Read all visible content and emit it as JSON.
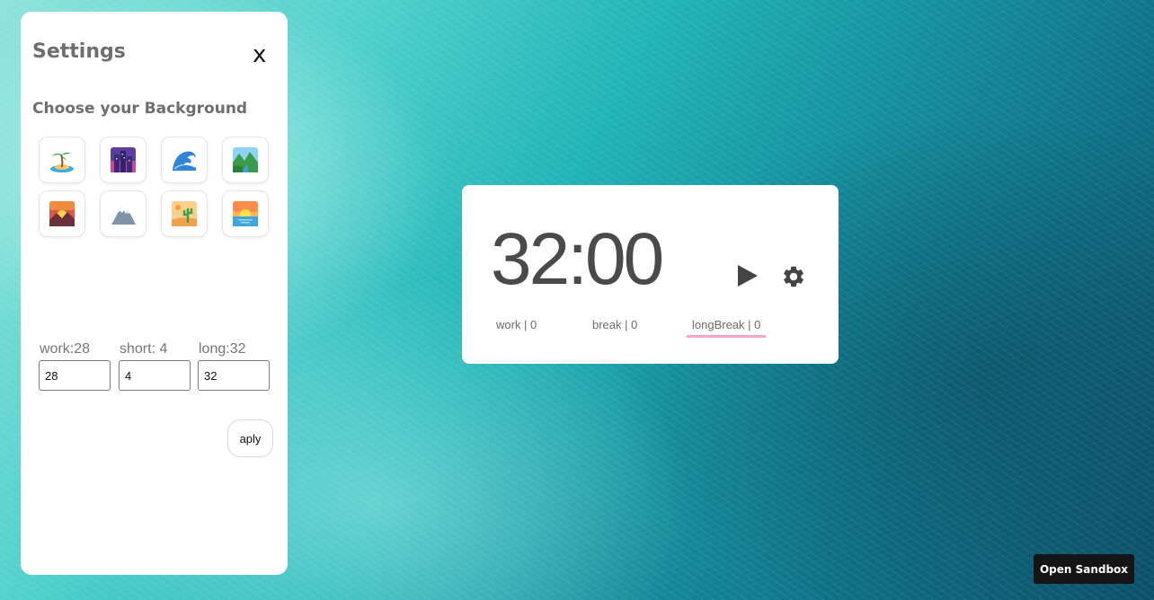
{
  "settings": {
    "title": "Settings",
    "close_label": "x",
    "background_heading": "Choose your Background",
    "backgrounds": [
      {
        "icon": "desert-island-icon"
      },
      {
        "icon": "city-night-icon"
      },
      {
        "icon": "water-wave-icon"
      },
      {
        "icon": "national-park-icon"
      },
      {
        "icon": "sunrise-over-mountains-icon"
      },
      {
        "icon": "snow-capped-mountain-icon"
      },
      {
        "icon": "desert-icon"
      },
      {
        "icon": "sunrise-icon"
      }
    ],
    "fields": [
      {
        "label": "work:28",
        "value": "28"
      },
      {
        "label": "short: 4",
        "value": "4"
      },
      {
        "label": "long:32",
        "value": "32"
      }
    ],
    "apply_label": "aply"
  },
  "timer": {
    "display": "32:00",
    "modes": [
      {
        "label": "work | 0",
        "active": false
      },
      {
        "label": "break | 0",
        "active": false
      },
      {
        "label": "longBreak | 0",
        "active": true
      }
    ],
    "active_underline_color": "#f3a6c6"
  },
  "footer": {
    "open_sandbox_label": "Open Sandbox"
  }
}
